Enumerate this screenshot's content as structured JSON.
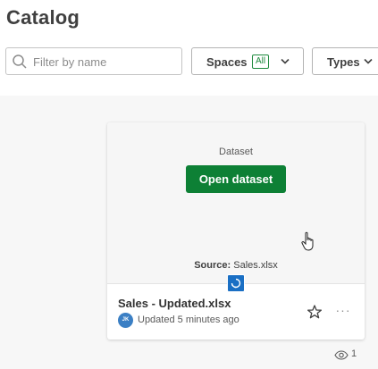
{
  "page": {
    "title": "Catalog"
  },
  "toolbar": {
    "search_placeholder": "Filter by name",
    "spaces": {
      "label": "Spaces",
      "badge": "All"
    },
    "types": {
      "label": "Types"
    }
  },
  "card": {
    "preview_type": "Dataset",
    "open_button": "Open dataset",
    "source_label": "Source:",
    "source_value": "Sales.xlsx",
    "title": "Sales - Updated.xlsx",
    "owner_initials": "JK",
    "updated_text": "Updated 5 minutes ago",
    "more_label": "···"
  },
  "footer": {
    "views_count": "1"
  },
  "colors": {
    "accent_green": "#0d8035",
    "badge_green": "#1f8a3e",
    "app_icon_blue": "#1a6fc4",
    "avatar_blue": "#3b7fc4",
    "content_background": "#f7f7f7"
  },
  "icons": {
    "search": "search-icon",
    "chevron": "chevron-down-icon",
    "star": "star-icon",
    "more": "more-options-icon",
    "eye": "eye-icon",
    "app": "dataset-app-icon",
    "cursor": "hand-pointer-icon"
  }
}
